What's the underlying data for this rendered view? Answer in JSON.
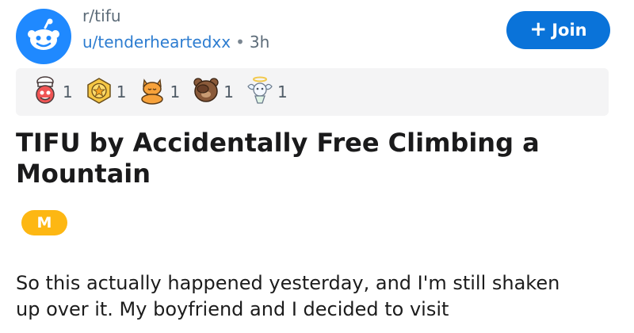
{
  "header": {
    "subreddit": "r/tifu",
    "username": "u/tenderheartedxx",
    "separator": "•",
    "time": "3h",
    "join_label": "Join",
    "join_icon": "plus-icon",
    "avatar_icon": "snoo-icon"
  },
  "awards": [
    {
      "icon": "chef-award-icon",
      "count": "1"
    },
    {
      "icon": "gold-medal-award-icon",
      "count": "1"
    },
    {
      "icon": "meditating-cat-award-icon",
      "count": "1"
    },
    {
      "icon": "facepalm-bear-award-icon",
      "count": "1"
    },
    {
      "icon": "angel-award-icon",
      "count": "1"
    }
  ],
  "post": {
    "title": "TIFU by Accidentally Free Climbing a Mountain",
    "flair": "M",
    "body": "So this actually happened yesterday, and I'm still shaken up over it. My boyfriend and I decided to visit"
  },
  "colors": {
    "accent": "#0a73d9",
    "avatar": "#1f89ff",
    "flair": "#fdb713",
    "muted": "#5c6b78",
    "link": "#2c7cd0"
  }
}
